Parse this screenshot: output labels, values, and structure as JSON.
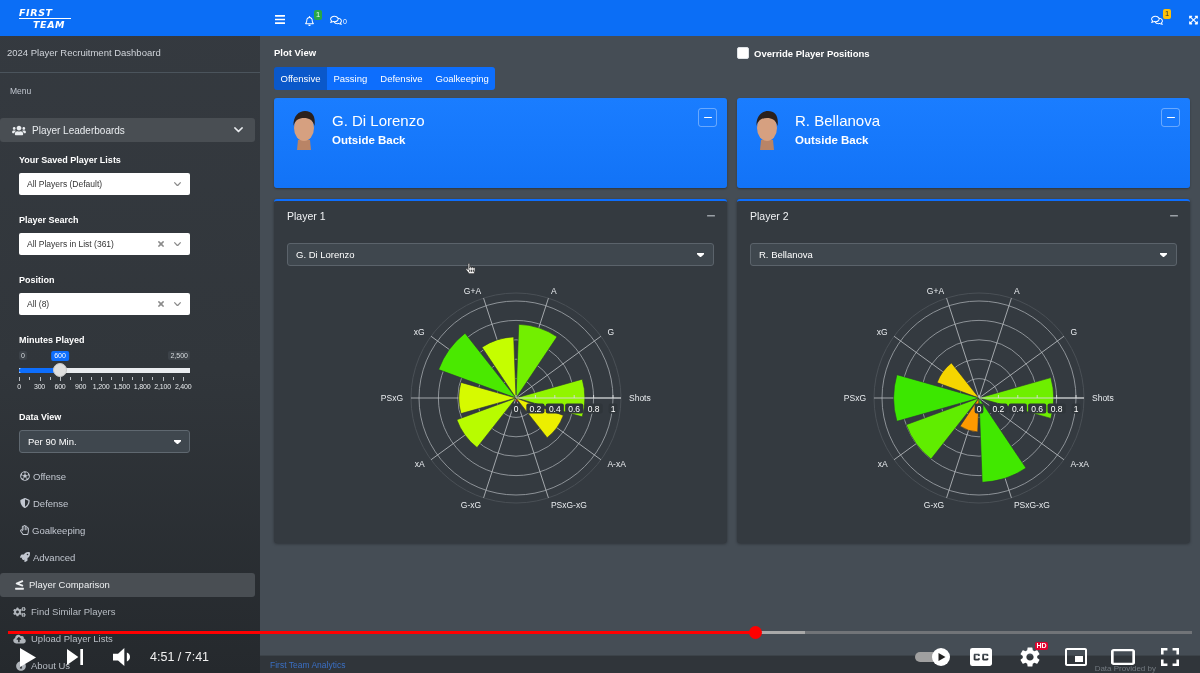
{
  "brand": {
    "line_1": "FIRST",
    "line_2": "TEAM"
  },
  "sidebar": {
    "title": "2024 Player Recruitment Dashboard",
    "menu_header": "Menu",
    "leaderboards": {
      "label": "Player Leaderboards",
      "expanded": true,
      "filters": [
        {
          "kind": "select",
          "label": "Your Saved Player Lists",
          "value": "All Players (Default)",
          "clearable": false
        },
        {
          "kind": "select",
          "label": "Player Search",
          "value": "All Players in List (361)",
          "clearable": true
        },
        {
          "kind": "select",
          "label": "Position",
          "value": "All (8)",
          "clearable": true
        },
        {
          "kind": "slider",
          "label": "Minutes Played",
          "min_label": "0",
          "max_label": "2,500",
          "value": "600",
          "level": 0.24,
          "ticks": [
            "0",
            "300",
            "600",
            "900",
            "1,200",
            "1,500",
            "1,800",
            "2,100",
            "2,400"
          ]
        },
        {
          "kind": "dropdown",
          "label": "Data View",
          "value": "Per 90 Min."
        }
      ],
      "children": [
        {
          "label": "Offense"
        },
        {
          "label": "Defense"
        },
        {
          "label": "Goalkeeping"
        },
        {
          "label": "Advanced"
        }
      ]
    },
    "nav_items": [
      {
        "label": "Player Comparison",
        "selected": true
      },
      {
        "label": "Find Similar Players",
        "selected": false
      },
      {
        "label": "Upload Player Lists",
        "selected": false
      },
      {
        "label": "About Us",
        "selected": false
      }
    ]
  },
  "top_nav": {
    "notifications_badge": "1",
    "messages_count": "0",
    "right_messages_badge": "1"
  },
  "main": {
    "plot_view": {
      "label": "Plot View",
      "tabs": [
        {
          "label": "Offensive",
          "selected": true
        },
        {
          "label": "Passing",
          "selected": false
        },
        {
          "label": "Defensive",
          "selected": false
        },
        {
          "label": "Goalkeeping",
          "selected": false
        }
      ]
    },
    "override": {
      "label": "Override Player Positions",
      "checked": false
    },
    "players": [
      {
        "name": "G. Di Lorenzo",
        "position": "Outside Back",
        "panel_title": "Player 1",
        "select_value": "G. Di Lorenzo",
        "polar_chart": {
          "radial_ticks": [
            "0",
            "0.2",
            "0.4",
            "0.6",
            "0.8",
            "1"
          ],
          "spokes": [
            {
              "label": "Shots",
              "level": 0.71
            },
            {
              "label": "G"
            },
            {
              "label": "A",
              "level": 0.76
            },
            {
              "label": "G+A",
              "level": 0.63
            },
            {
              "label": "xG",
              "level": 0.85
            },
            {
              "label": "PSxG",
              "level": 0.59
            },
            {
              "label": "xA",
              "level": 0.65
            },
            {
              "label": "G-xG"
            },
            {
              "label": "PSxG-xG",
              "level": 0.04
            },
            {
              "label": "A-xA",
              "level": 0.52
            }
          ]
        }
      },
      {
        "name": "R. Bellanova",
        "position": "Outside Back",
        "panel_title": "Player 2",
        "select_value": "R. Bellanova",
        "polar_chart": {
          "radial_ticks": [
            "0",
            "0.2",
            "0.4",
            "0.6",
            "0.8",
            "1"
          ],
          "spokes": [
            {
              "label": "Shots",
              "level": 0.77
            },
            {
              "label": "G"
            },
            {
              "label": "A"
            },
            {
              "label": "G+A"
            },
            {
              "label": "xG",
              "level": 0.46
            },
            {
              "label": "PSxG",
              "level": 0.88
            },
            {
              "label": "xA",
              "level": 0.8
            },
            {
              "label": "G-xG",
              "level": 0.35
            },
            {
              "label": "PSxG-xG",
              "level": 0.87
            },
            {
              "label": "A-xA"
            }
          ]
        }
      }
    ]
  },
  "footer": {
    "link": "First Team Analytics",
    "credit": "Data Provided by"
  },
  "video_player": {
    "progress": {
      "level": 0.631
    },
    "buffered": {
      "level": 0.673
    },
    "time": "4:51 / 7:41",
    "autoplay": {
      "on": true
    },
    "settings_badge": "HD"
  }
}
